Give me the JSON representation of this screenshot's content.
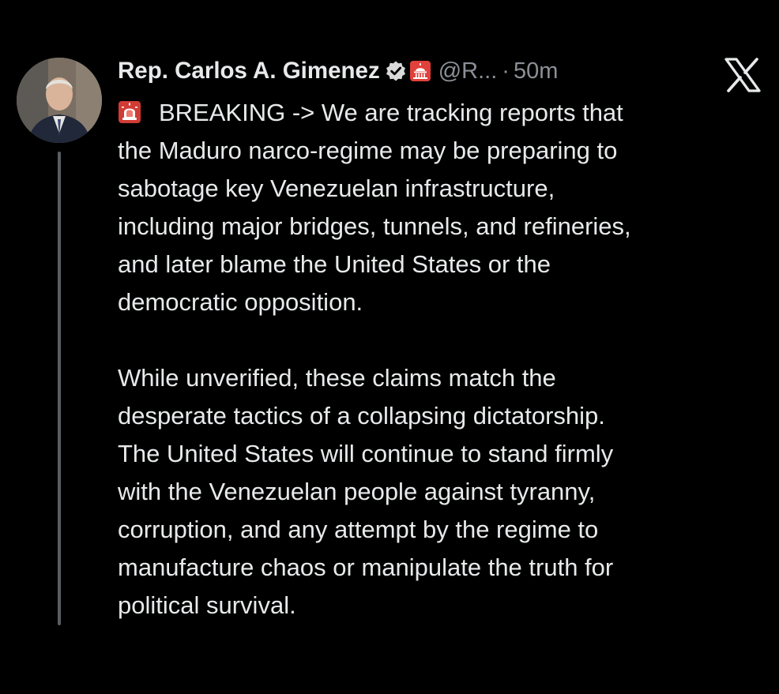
{
  "tweet": {
    "display_name": "Rep. Carlos A. Gimenez",
    "handle": "@R...",
    "separator": "·",
    "time": "50m",
    "verified_icon": "verified-badge-icon",
    "affiliation_icon": "capitol-dome-icon",
    "platform_logo": "x-logo-icon",
    "paragraph1": {
      "icon": "siren-icon",
      "lines": [
        "BREAKING -> We are tracking  reports that",
        "the Maduro narco-regime may be preparing to",
        "sabotage key Venezuelan infrastructure,",
        "including major bridges, tunnels, and refineries,",
        "and later blame the United States or the",
        "democratic opposition."
      ]
    },
    "paragraph2": {
      "lines": [
        "While unverified, these claims match the",
        "desperate tactics of a collapsing dictatorship.",
        "The United States will continue to stand firmly",
        "with the Venezuelan people against tyranny,",
        "corruption, and any attempt by the regime to",
        "manufacture chaos or manipulate the truth for",
        "political survival."
      ]
    }
  },
  "colors": {
    "background": "#000000",
    "text_primary": "#e7e9ea",
    "text_secondary": "#8b9096",
    "verified_badge": "#d9d9d9",
    "affiliation_badge": "#e0413a",
    "thread_line": "#5a5e62"
  }
}
